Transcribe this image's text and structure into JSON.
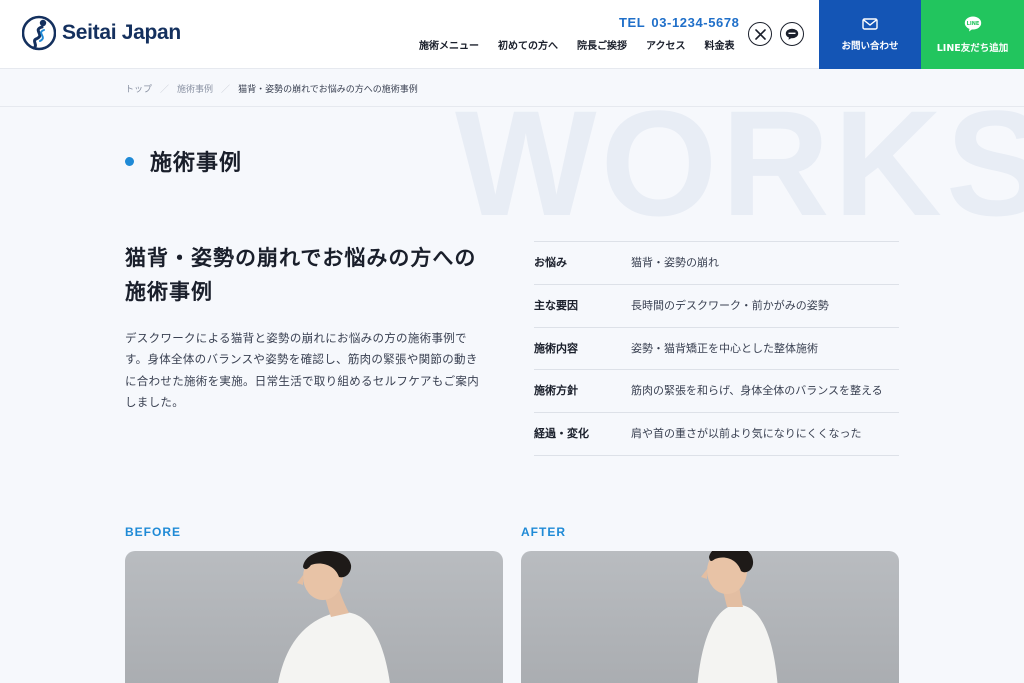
{
  "header": {
    "logo_text": "Seitai Japan",
    "tel_label": "TEL",
    "tel_number": "03-1234-5678",
    "nav": [
      "施術メニュー",
      "初めての方へ",
      "院長ご挨拶",
      "アクセス",
      "料金表"
    ],
    "contact_label": "お問い合わせ",
    "line_label": "LINE友だち追加",
    "social": [
      "x-icon",
      "line-icon"
    ],
    "colors": {
      "brand": "#14305e",
      "contact": "#1455b5",
      "line": "#22c55e",
      "accent": "#1f8ad6"
    }
  },
  "breadcrumb": [
    "トップ",
    "施術事例",
    "猫背・姿勢の崩れでお悩みの方への施術事例"
  ],
  "watermark": "WORKS",
  "section_title": "施術事例",
  "case": {
    "title": "猫背・姿勢の崩れでお悩みの方への施術事例",
    "description": "デスクワークによる猫背と姿勢の崩れにお悩みの方の施術事例です。身体全体のバランスや姿勢を確認し、筋肉の緊張や関節の動きに合わせた施術を実施。日常生活で取り組めるセルフケアもご案内しました。"
  },
  "info": [
    {
      "label": "お悩み",
      "value": "猫背・姿勢の崩れ"
    },
    {
      "label": "主な要因",
      "value": "長時間のデスクワーク・前かがみの姿勢"
    },
    {
      "label": "施術内容",
      "value": "姿勢・猫背矯正を中心とした整体施術"
    },
    {
      "label": "施術方針",
      "value": "筋肉の緊張を和らげ、身体全体のバランスを整える"
    },
    {
      "label": "経過・変化",
      "value": "肩や首の重さが以前より気になりにくくなった"
    }
  ],
  "before_label": "BEFORE",
  "after_label": "AFTER"
}
